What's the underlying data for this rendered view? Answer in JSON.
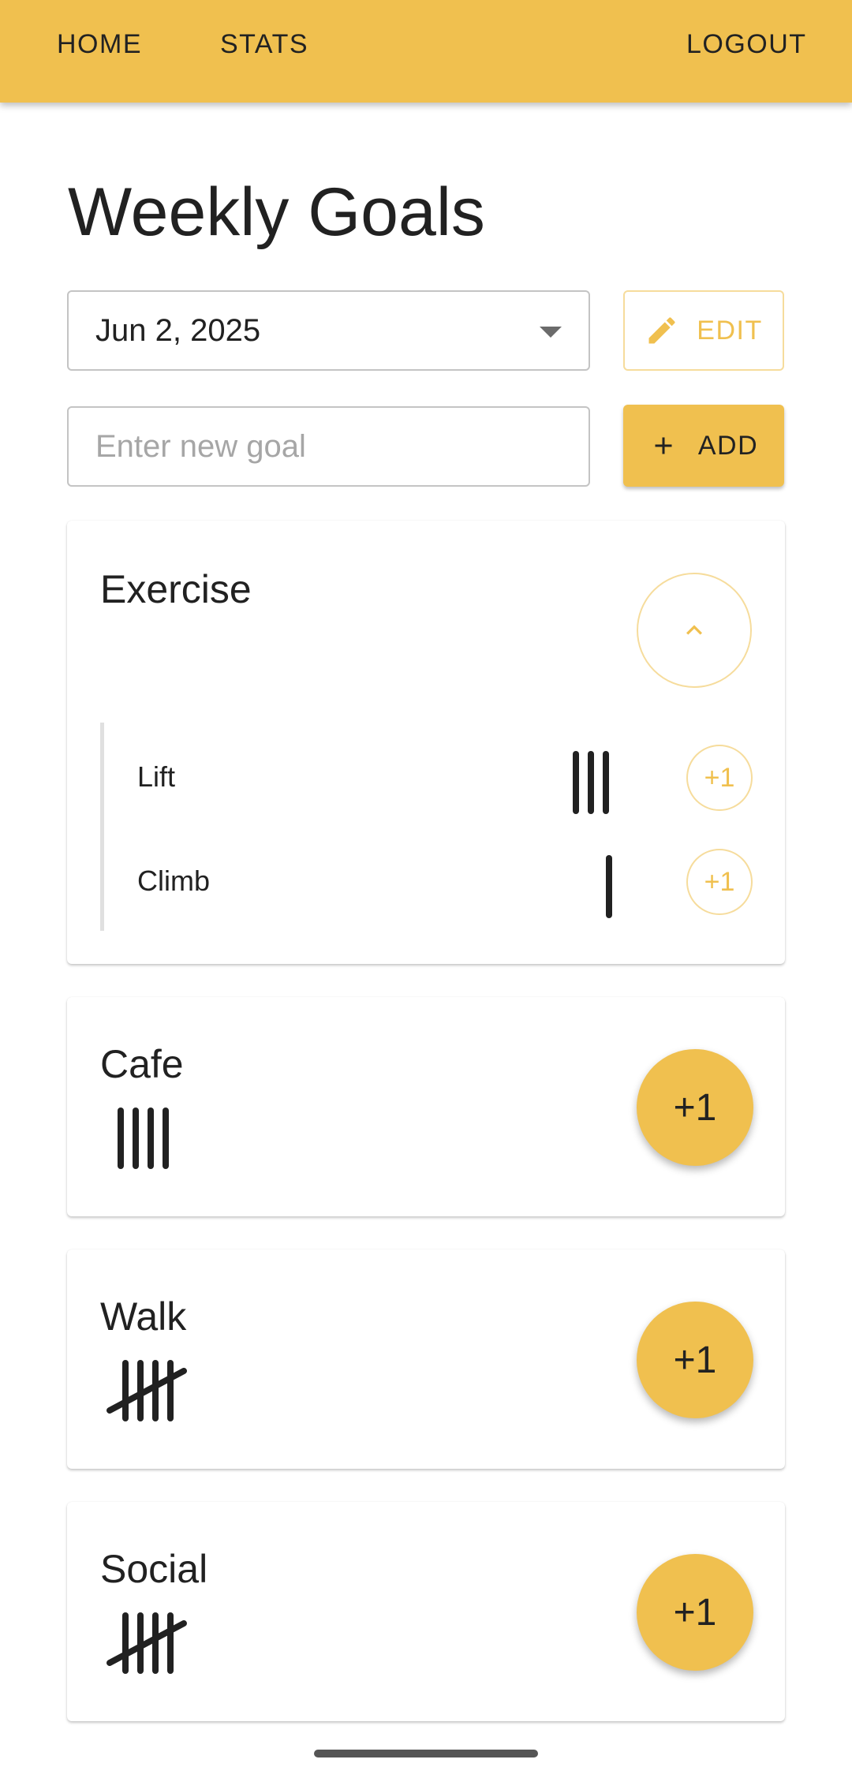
{
  "nav": {
    "home": "HOME",
    "stats": "STATS",
    "logout": "LOGOUT"
  },
  "page": {
    "title": "Weekly Goals"
  },
  "date_select": {
    "value": "Jun 2, 2025"
  },
  "edit_button": {
    "label": "EDIT"
  },
  "new_goal": {
    "placeholder": "Enter new goal",
    "value": ""
  },
  "add_button": {
    "label": "ADD"
  },
  "colors": {
    "accent": "#F0C04F",
    "accent_light": "#f6dc9c",
    "text": "#212121"
  },
  "goals": [
    {
      "name": "Exercise",
      "expanded": true,
      "icon": "chevron-up-icon",
      "subgoals": [
        {
          "name": "Lift",
          "count": 3,
          "button": "+1"
        },
        {
          "name": "Climb",
          "count": 1,
          "button": "+1"
        }
      ]
    },
    {
      "name": "Cafe",
      "count": 4,
      "button": "+1"
    },
    {
      "name": "Walk",
      "count": 5,
      "button": "+1"
    },
    {
      "name": "Social",
      "count": 5,
      "button": "+1"
    }
  ]
}
